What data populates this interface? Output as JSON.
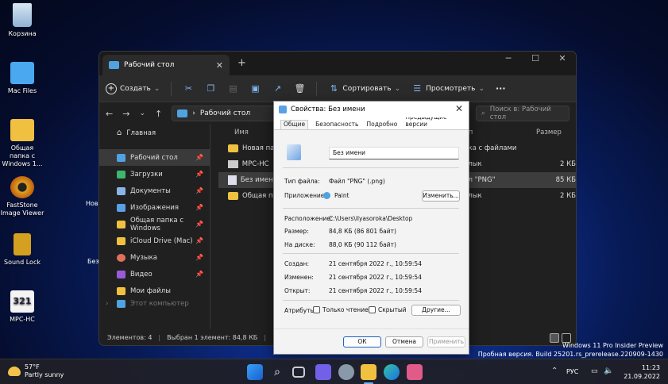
{
  "desktop": {
    "icons": [
      {
        "label": "Корзина",
        "icon": "recycle-bin-icon"
      },
      {
        "label": "Mac Files",
        "icon": "folder-icon"
      },
      {
        "label": "Общая папка с Windows 1...",
        "icon": "shared-folder-icon"
      },
      {
        "label": "FastStone Image Viewer",
        "icon": "faststone-icon"
      },
      {
        "label": "Sound Lock",
        "icon": "lock-icon"
      },
      {
        "label": "MPC-HC",
        "icon": "mpc-hc-icon"
      }
    ],
    "partial_labels": [
      "Нов",
      "Без"
    ],
    "watermark": {
      "line1": "Windows 11 Pro Insider Preview",
      "line2": "Пробная версия. Build 25201.rs_prerelease.220909-1430"
    }
  },
  "explorer": {
    "tab_title": "Рабочий стол",
    "toolbar": {
      "create": "Создать",
      "sort": "Сортировать",
      "view": "Просмотреть",
      "more": "···"
    },
    "address": "Рабочий стол",
    "search_placeholder": "Поиск в: Рабочий стол",
    "nav": [
      {
        "label": "Главная",
        "pinned": false
      },
      {
        "label": "Рабочий стол",
        "pinned": true
      },
      {
        "label": "Загрузки",
        "pinned": true
      },
      {
        "label": "Документы",
        "pinned": true
      },
      {
        "label": "Изображения",
        "pinned": true
      },
      {
        "label": "Общая папка с Windows",
        "pinned": true
      },
      {
        "label": "iCloud Drive (Mac)",
        "pinned": true
      },
      {
        "label": "Музыка",
        "pinned": true
      },
      {
        "label": "Видео",
        "pinned": true
      },
      {
        "label": "Мои файлы",
        "pinned": false
      },
      {
        "label": "Этот компьютер",
        "pinned": false
      }
    ],
    "columns": {
      "name": "Имя",
      "type": "Тип",
      "size": "Размер"
    },
    "files": [
      {
        "name": "Новая папка",
        "type": "лка с файлами",
        "size": ""
      },
      {
        "name": "MPC-HC",
        "type": "рлык",
        "size": "2 КБ"
      },
      {
        "name": "Без имени",
        "type": "йл \"PNG\"",
        "size": "85 КБ"
      },
      {
        "name": "Общая папк",
        "type": "рлык",
        "size": "2 КБ"
      }
    ],
    "status": {
      "items": "Элементов: 4",
      "selected": "Выбран 1 элемент: 84,8 КБ"
    }
  },
  "dialog": {
    "title": "Свойства: Без имени",
    "tabs": [
      "Общие",
      "Безопасность",
      "Подробно",
      "Предыдущие версии"
    ],
    "file_name": "Без имени",
    "file_type_label": "Тип файла:",
    "file_type": "Файл \"PNG\" (.png)",
    "app_label": "Приложение:",
    "app": "Paint",
    "change_btn": "Изменить...",
    "location_label": "Расположение:",
    "location": "C:\\Users\\ilyasoroka\\Desktop",
    "size_label": "Размер:",
    "size": "84,8 КБ (86 801 байт)",
    "disk_label": "На диске:",
    "disk": "88,0 КБ (90 112 байт)",
    "created_label": "Создан:",
    "created": "21 сентября 2022 г., 10:59:54",
    "modified_label": "Изменен:",
    "modified": "21 сентября 2022 г., 10:59:54",
    "opened_label": "Открыт:",
    "opened": "21 сентября 2022 г., 10:59:54",
    "attr_label": "Атрибуты:",
    "readonly": "Только чтение",
    "hidden": "Скрытый",
    "other_btn": "Другие...",
    "ok": "ОК",
    "cancel": "Отмена",
    "apply": "Применить"
  },
  "taskbar": {
    "weather_temp": "57°F",
    "weather_desc": "Partly sunny",
    "lang": "РУС",
    "time": "11:23",
    "date": "21.09.2022"
  },
  "colors": {
    "accent": "#1a63c7",
    "folder": "#f0c040",
    "desktop_blue": "#0f2f8f"
  }
}
